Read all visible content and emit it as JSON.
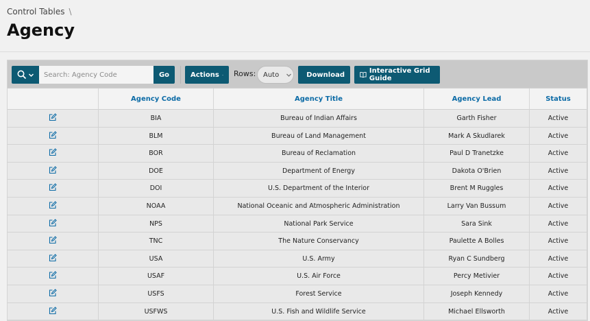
{
  "breadcrumb": {
    "item": "Control Tables",
    "separator": "\\"
  },
  "page_title": "Agency",
  "toolbar": {
    "search_placeholder": "Search: Agency Code",
    "go_label": "Go",
    "actions_label": "Actions",
    "rows_label": "Rows:",
    "rows_value": "Auto",
    "download_label": "Download",
    "guide_label": "Interactive Grid Guide"
  },
  "columns": [
    "",
    "Agency Code",
    "Agency Title",
    "Agency Lead",
    "Status"
  ],
  "rows": [
    {
      "code": "BIA",
      "title": "Bureau of Indian Affairs",
      "lead": "Garth Fisher",
      "status": "Active"
    },
    {
      "code": "BLM",
      "title": "Bureau of Land Management",
      "lead": "Mark A Skudlarek",
      "status": "Active"
    },
    {
      "code": "BOR",
      "title": "Bureau of Reclamation",
      "lead": "Paul D Tranetzke",
      "status": "Active"
    },
    {
      "code": "DOE",
      "title": "Department of Energy",
      "lead": "Dakota O'Brien",
      "status": "Active"
    },
    {
      "code": "DOI",
      "title": "U.S. Department of the Interior",
      "lead": "Brent M Ruggles",
      "status": "Active"
    },
    {
      "code": "NOAA",
      "title": "National Oceanic and Atmospheric Administration",
      "lead": "Larry Van Bussum",
      "status": "Active"
    },
    {
      "code": "NPS",
      "title": "National Park Service",
      "lead": "Sara Sink",
      "status": "Active"
    },
    {
      "code": "TNC",
      "title": "The Nature Conservancy",
      "lead": "Paulette A Bolles",
      "status": "Active"
    },
    {
      "code": "USA",
      "title": "U.S. Army",
      "lead": "Ryan C Sundberg",
      "status": "Active"
    },
    {
      "code": "USAF",
      "title": "U.S. Air Force",
      "lead": "Percy Metivier",
      "status": "Active"
    },
    {
      "code": "USFS",
      "title": "Forest Service",
      "lead": "Joseph Kennedy",
      "status": "Active"
    },
    {
      "code": "USFWS",
      "title": "U.S. Fish and Wildlife Service",
      "lead": "Michael Ellsworth",
      "status": "Active"
    }
  ],
  "colors": {
    "button": "#0d5a73",
    "header_link": "#0c6ba6",
    "row_bg": "#e9e9e9"
  }
}
